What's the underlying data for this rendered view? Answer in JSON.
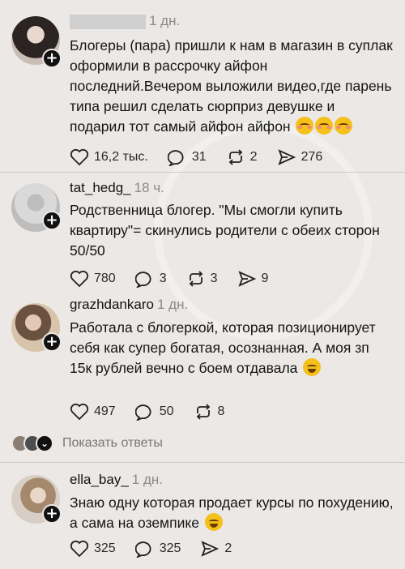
{
  "posts": [
    {
      "time": "1 дн.",
      "text": "Блогеры (пара) пришли к нам в магазин в суплак оформили в рассрочку айфон последний.Вечером выложили видео,где парень типа решил сделать сюрприз девушке и подарил тот самый айфон айфон",
      "likes": "16,2 тыс.",
      "comments": "31",
      "reposts": "2",
      "shares": "276"
    },
    {
      "user": "tat_hedg_",
      "time": "18 ч.",
      "text": "Родственница блогер. \"Мы смогли купить квартиру\"= скинулись родители с обеих сторон 50/50",
      "likes": "780",
      "comments": "3",
      "reposts": "3",
      "shares": "9"
    },
    {
      "user": "grazhdankaro",
      "time": "1 дн.",
      "text": "Работала с блогеркой, которая позиционирует себя как супер богатая, осознанная. А моя зп 15к рублей вечно с боем отдавала",
      "likes": "497",
      "comments": "50",
      "reposts": "8"
    },
    {
      "user": "ella_bay_",
      "time": "1 дн.",
      "text": "Знаю одну которая продает курсы по похудению, а сама на оземпике",
      "likes": "325",
      "comments": "325",
      "shares": "2"
    }
  ],
  "show_replies_label": "Показать ответы",
  "colors": {
    "background": "#ebe8e6",
    "muted": "#8a8a8a",
    "divider": "#cfcac6"
  }
}
